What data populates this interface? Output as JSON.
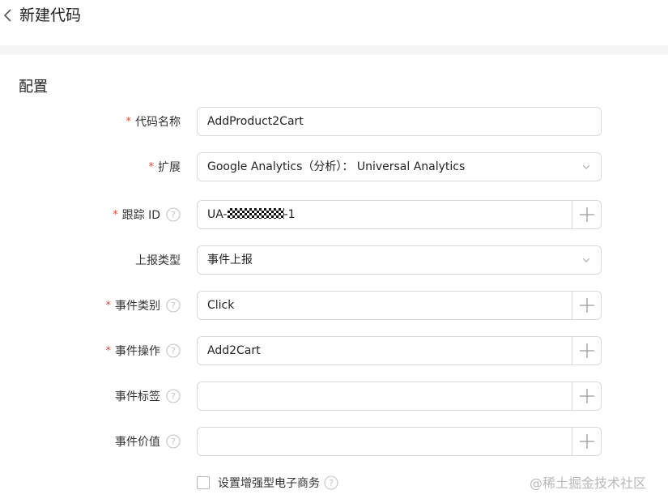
{
  "header": {
    "title": "新建代码",
    "back_icon": "chevron-left-icon"
  },
  "section": {
    "title": "配置"
  },
  "form": {
    "required_mark": "*",
    "fields": [
      {
        "label": "代码名称",
        "required": true,
        "help": false,
        "type": "text",
        "value": "AddProduct2Cart"
      },
      {
        "label": "扩展",
        "required": true,
        "help": false,
        "type": "select",
        "value": "Google Analytics（分析）： Universal Analytics"
      },
      {
        "label": "跟踪 ID",
        "required": true,
        "help": true,
        "type": "text-add",
        "value_prefix": "UA-",
        "value_suffix": "-1",
        "value_masked": true
      },
      {
        "label": "上报类型",
        "required": false,
        "help": false,
        "type": "select",
        "value": "事件上报"
      },
      {
        "label": "事件类别",
        "required": true,
        "help": true,
        "type": "text-add",
        "value": "Click"
      },
      {
        "label": "事件操作",
        "required": true,
        "help": true,
        "type": "text-add",
        "value": "Add2Cart"
      },
      {
        "label": "事件标签",
        "required": false,
        "help": true,
        "type": "text-add",
        "value": ""
      },
      {
        "label": "事件价值",
        "required": false,
        "help": true,
        "type": "text-add",
        "value": ""
      }
    ],
    "checkbox": {
      "label": "设置增强型电子商务",
      "checked": false
    }
  },
  "watermark": "@稀土掘金技术社区",
  "colors": {
    "required": "#e04a3a",
    "border": "#d9d9d9",
    "band": "#f5f5f5"
  }
}
